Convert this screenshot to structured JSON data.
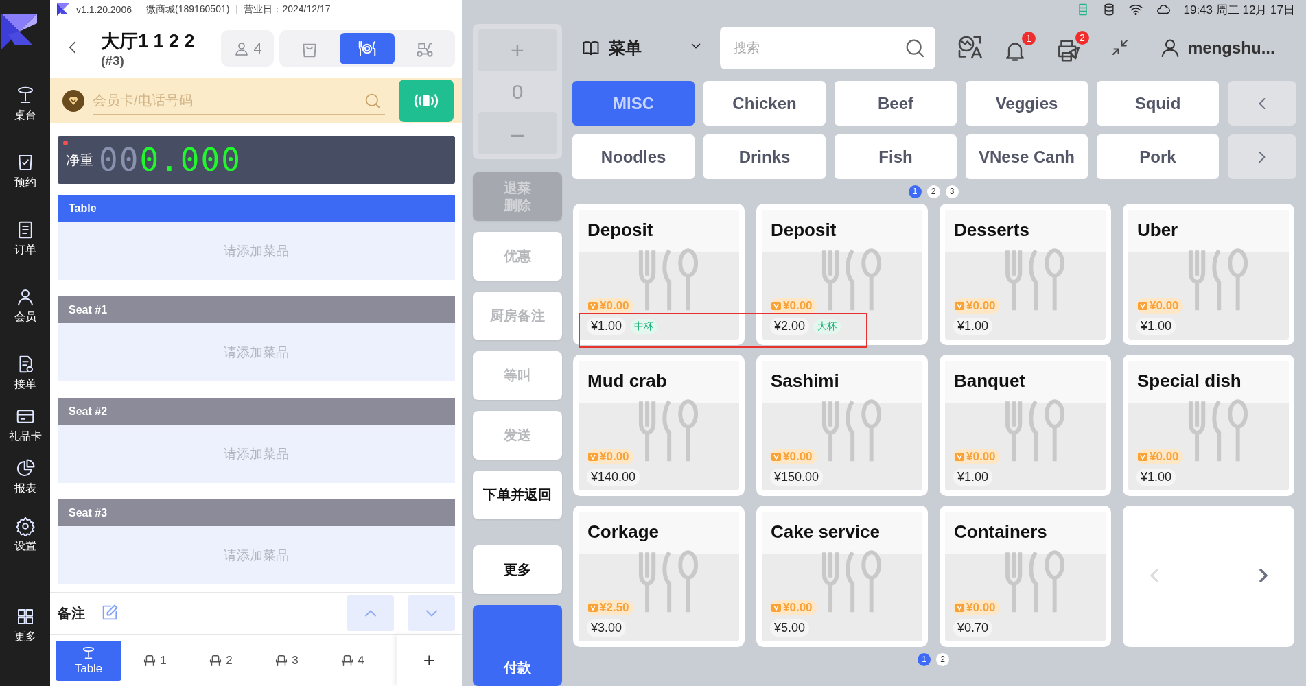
{
  "app": {
    "version": "v1.1.20.2006",
    "store": "微商城(189160501)",
    "business_day": "营业日：2024/12/17"
  },
  "nav": [
    {
      "kind": "table",
      "label": "桌台"
    },
    {
      "kind": "booking",
      "label": "预约"
    },
    {
      "kind": "orders",
      "label": "订单"
    },
    {
      "kind": "member",
      "label": "会员"
    },
    {
      "kind": "accept",
      "label": "接单"
    },
    {
      "kind": "giftcard",
      "label": "礼品卡"
    },
    {
      "kind": "report",
      "label": "报表"
    },
    {
      "kind": "settings",
      "label": "设置"
    },
    {
      "kind": "more",
      "label": "更多"
    }
  ],
  "order": {
    "title": "大厅1 1 2 2",
    "number": "(#3)",
    "guests": "4",
    "modes": [
      {
        "kind": "takeaway",
        "selected": false
      },
      {
        "kind": "dine-in",
        "selected": true
      },
      {
        "kind": "delivery",
        "selected": false
      }
    ]
  },
  "member_search": {
    "placeholder": "会员卡/电话号码"
  },
  "scale": {
    "label": "净重",
    "idle_digits": "00",
    "reading": "0.000"
  },
  "sections": [
    {
      "kind": "table",
      "title": "Table",
      "empty_text": "请添加菜品"
    },
    {
      "kind": "seat",
      "title": "Seat #1",
      "empty_text": "请添加菜品"
    },
    {
      "kind": "seat",
      "title": "Seat #2",
      "empty_text": "请添加菜品"
    },
    {
      "kind": "seat",
      "title": "Seat #3",
      "empty_text": "请添加菜品"
    }
  ],
  "remark": {
    "label": "备注"
  },
  "seat_tabs": [
    {
      "kind": "table",
      "label": "Table",
      "selected": true
    },
    {
      "kind": "seat",
      "label": "1",
      "selected": false
    },
    {
      "kind": "seat",
      "label": "2",
      "selected": false
    },
    {
      "kind": "seat",
      "label": "3",
      "selected": false
    },
    {
      "kind": "seat",
      "label": "4",
      "selected": false
    }
  ],
  "add_seat": "+",
  "quantity": {
    "plus": "+",
    "value": "0",
    "minus": "–"
  },
  "actions": [
    {
      "kind": "disabled",
      "lines": [
        "退菜",
        "删除"
      ]
    },
    {
      "kind": "muted",
      "lines": [
        "优惠"
      ]
    },
    {
      "kind": "muted",
      "lines": [
        "厨房备注"
      ]
    },
    {
      "kind": "muted",
      "lines": [
        "等叫"
      ]
    },
    {
      "kind": "muted",
      "lines": [
        "发送"
      ]
    },
    {
      "kind": "normal",
      "lines": [
        "下单并返回"
      ]
    },
    {
      "kind": "normal",
      "lines": [
        "更多"
      ]
    },
    {
      "kind": "primary",
      "lines": [
        "付款"
      ]
    }
  ],
  "status_bar": {
    "clock": "19:43 周二 12月 17日"
  },
  "toolbar": {
    "menu_label": "菜单",
    "search_placeholder": "搜索",
    "notifications": "1",
    "print_jobs": "2",
    "user": "mengshu..."
  },
  "categories": [
    {
      "label": "MISC",
      "selected": true
    },
    {
      "label": "Chicken",
      "selected": false
    },
    {
      "label": "Beef",
      "selected": false
    },
    {
      "label": "Veggies",
      "selected": false
    },
    {
      "label": "Squid",
      "selected": false
    },
    {
      "label": "Noodles",
      "selected": false
    },
    {
      "label": "Drinks",
      "selected": false
    },
    {
      "label": "Fish",
      "selected": false
    },
    {
      "label": "VNese Canh",
      "selected": false
    },
    {
      "label": "Pork",
      "selected": false
    }
  ],
  "category_pages": [
    {
      "label": "1",
      "selected": true
    },
    {
      "label": "2",
      "selected": false
    },
    {
      "label": "3",
      "selected": false
    }
  ],
  "products": [
    {
      "name": "Deposit",
      "member_price": "¥0.00",
      "price": "¥1.00",
      "tag": "中杯",
      "highlighted": true
    },
    {
      "name": "Deposit",
      "member_price": "¥0.00",
      "price": "¥2.00",
      "tag": "大杯",
      "highlighted": true
    },
    {
      "name": "Desserts",
      "member_price": "¥0.00",
      "price": "¥1.00",
      "highlighted": false
    },
    {
      "name": "Uber",
      "member_price": "¥0.00",
      "price": "¥1.00",
      "highlighted": false
    },
    {
      "name": "Mud crab",
      "member_price": "¥0.00",
      "price": "¥140.00",
      "highlighted": false
    },
    {
      "name": "Sashimi",
      "member_price": "¥0.00",
      "price": "¥150.00",
      "highlighted": false
    },
    {
      "name": "Banquet",
      "member_price": "¥0.00",
      "price": "¥1.00",
      "highlighted": false
    },
    {
      "name": "Special dish",
      "member_price": "¥0.00",
      "price": "¥1.00",
      "highlighted": false
    },
    {
      "name": "Corkage",
      "member_price": "¥2.50",
      "price": "¥3.00",
      "highlighted": false
    },
    {
      "name": "Cake service",
      "member_price": "¥0.00",
      "price": "¥5.00",
      "highlighted": false
    },
    {
      "name": "Containers",
      "member_price": "¥0.00",
      "price": "¥0.70",
      "highlighted": false
    }
  ],
  "product_pages": [
    {
      "label": "1",
      "selected": true
    },
    {
      "label": "2",
      "selected": false
    }
  ]
}
